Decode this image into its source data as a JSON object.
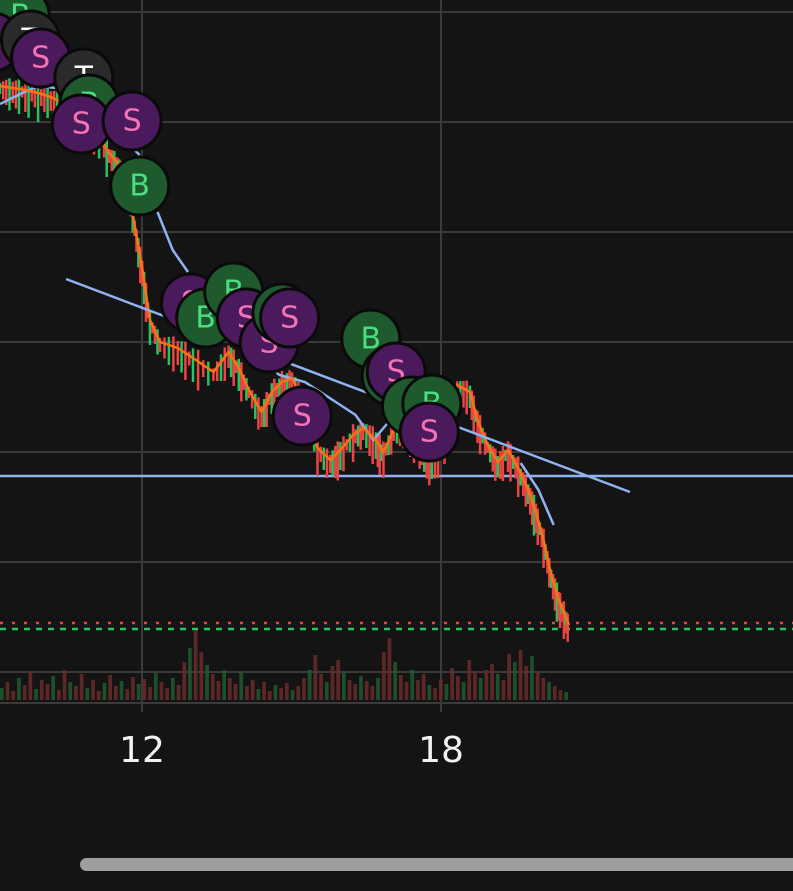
{
  "chart_data": {
    "type": "candlestick",
    "x_ticks": [
      "12",
      "18"
    ],
    "grid": true,
    "colors": {
      "background": "#141414",
      "grid": "#3a3a3a",
      "up_candle": "#22c55e",
      "down_candle": "#ef4444",
      "price_line": "#f97316",
      "moving_average": "#8fb3f0",
      "trendline": "#8fb3f0",
      "support_line": "#8fb3f0",
      "last_price_dotted": "#ef4444",
      "reference_dashed": "#22c55e",
      "buy_marker_fill": "#1f5a2e",
      "buy_marker_text": "#4ade80",
      "sell_marker_fill": "#4a1a5c",
      "sell_marker_text": "#f472b6",
      "volume": "#6b2a2a"
    },
    "price_series": [
      {
        "t": 0.0,
        "p": 86
      },
      {
        "t": 0.5,
        "p": 88
      },
      {
        "t": 1.0,
        "p": 90
      },
      {
        "t": 1.5,
        "p": 93
      },
      {
        "t": 2.0,
        "p": 97
      },
      {
        "t": 2.5,
        "p": 103
      },
      {
        "t": 3.0,
        "p": 114
      },
      {
        "t": 3.4,
        "p": 122
      },
      {
        "t": 3.8,
        "p": 128
      },
      {
        "t": 4.2,
        "p": 150
      },
      {
        "t": 4.6,
        "p": 162
      },
      {
        "t": 4.8,
        "p": 175
      },
      {
        "t": 5.0,
        "p": 180
      },
      {
        "t": 5.3,
        "p": 225
      },
      {
        "t": 5.6,
        "p": 268
      },
      {
        "t": 5.9,
        "p": 320
      },
      {
        "t": 6.3,
        "p": 342
      },
      {
        "t": 7.0,
        "p": 348
      },
      {
        "t": 7.6,
        "p": 358
      },
      {
        "t": 8.4,
        "p": 372
      },
      {
        "t": 9.0,
        "p": 352
      },
      {
        "t": 9.4,
        "p": 368
      },
      {
        "t": 9.8,
        "p": 390
      },
      {
        "t": 10.3,
        "p": 412
      },
      {
        "t": 10.7,
        "p": 392
      },
      {
        "t": 11.1,
        "p": 382
      },
      {
        "t": 11.5,
        "p": 378
      },
      {
        "t": 12.0,
        "p": 405
      },
      {
        "t": 12.5,
        "p": 448
      },
      {
        "t": 13.0,
        "p": 460
      },
      {
        "t": 13.4,
        "p": 450
      },
      {
        "t": 13.9,
        "p": 435
      },
      {
        "t": 14.3,
        "p": 428
      },
      {
        "t": 14.8,
        "p": 440
      },
      {
        "t": 15.1,
        "p": 452
      },
      {
        "t": 15.5,
        "p": 430
      },
      {
        "t": 16.0,
        "p": 420
      },
      {
        "t": 16.3,
        "p": 438
      },
      {
        "t": 16.6,
        "p": 455
      },
      {
        "t": 17.0,
        "p": 462
      },
      {
        "t": 17.5,
        "p": 440
      },
      {
        "t": 18.0,
        "p": 385
      },
      {
        "t": 18.5,
        "p": 392
      },
      {
        "t": 18.8,
        "p": 420
      },
      {
        "t": 19.2,
        "p": 445
      },
      {
        "t": 19.6,
        "p": 462
      },
      {
        "t": 20.0,
        "p": 450
      },
      {
        "t": 20.4,
        "p": 468
      },
      {
        "t": 20.8,
        "p": 490
      },
      {
        "t": 21.1,
        "p": 512
      },
      {
        "t": 21.4,
        "p": 540
      },
      {
        "t": 21.7,
        "p": 575
      },
      {
        "t": 22.0,
        "p": 600
      },
      {
        "t": 22.2,
        "p": 612
      },
      {
        "t": 22.4,
        "p": 625
      }
    ],
    "moving_average": [
      {
        "t": 0.0,
        "p": 104
      },
      {
        "t": 0.8,
        "p": 94
      },
      {
        "t": 1.5,
        "p": 86
      },
      {
        "t": 2.2,
        "p": 88
      },
      {
        "t": 3.0,
        "p": 90
      },
      {
        "t": 4.0,
        "p": 108
      },
      {
        "t": 4.8,
        "p": 138
      },
      {
        "t": 5.5,
        "p": 155
      }
    ],
    "moving_average_2": [
      {
        "t": 6.2,
        "p": 212
      },
      {
        "t": 6.8,
        "p": 250
      },
      {
        "t": 7.4,
        "p": 272
      }
    ],
    "moving_average_3": [
      {
        "t": 9.0,
        "p": 330
      },
      {
        "t": 10.0,
        "p": 352
      },
      {
        "t": 11.0,
        "p": 375
      },
      {
        "t": 12.0,
        "p": 382
      },
      {
        "t": 12.8,
        "p": 395
      },
      {
        "t": 14.0,
        "p": 415
      },
      {
        "t": 14.7,
        "p": 440
      },
      {
        "t": 15.3,
        "p": 422
      }
    ],
    "moving_average_4": [
      {
        "t": 20.5,
        "p": 463
      },
      {
        "t": 21.2,
        "p": 490
      },
      {
        "t": 21.8,
        "p": 525
      }
    ],
    "trendline": {
      "from": {
        "t": 2.6,
        "p": 279
      },
      "to": {
        "t": 24.8,
        "p": 492
      }
    },
    "support_level": {
      "p": 476
    },
    "last_price_level": {
      "p": 623
    },
    "reference_level": {
      "p": 629
    },
    "markers": [
      {
        "kind": "B",
        "t": 0.8,
        "p": 16
      },
      {
        "kind": "S",
        "t": -0.3,
        "p": 42
      },
      {
        "kind": "T",
        "t": 1.2,
        "p": 40
      },
      {
        "kind": "S",
        "t": 1.6,
        "p": 58
      },
      {
        "kind": "T",
        "t": 3.3,
        "p": 78
      },
      {
        "kind": "B",
        "t": 3.5,
        "p": 104
      },
      {
        "kind": "S",
        "t": 3.2,
        "p": 124
      },
      {
        "kind": "S",
        "t": 5.2,
        "p": 121
      },
      {
        "kind": "B",
        "t": 5.5,
        "p": 186
      },
      {
        "kind": "S",
        "t": 7.5,
        "p": 303
      },
      {
        "kind": "B",
        "t": 8.1,
        "p": 318
      },
      {
        "kind": "B",
        "t": 9.2,
        "p": 292
      },
      {
        "kind": "S",
        "t": 9.7,
        "p": 318
      },
      {
        "kind": "S",
        "t": 10.6,
        "p": 343
      },
      {
        "kind": "B",
        "t": 11.1,
        "p": 313
      },
      {
        "kind": "S",
        "t": 11.4,
        "p": 318
      },
      {
        "kind": "S",
        "t": 11.9,
        "p": 416
      },
      {
        "kind": "B",
        "t": 14.6,
        "p": 339
      },
      {
        "kind": "B",
        "t": 15.4,
        "p": 376
      },
      {
        "kind": "S",
        "t": 15.6,
        "p": 372
      },
      {
        "kind": "B",
        "t": 16.2,
        "p": 406
      },
      {
        "kind": "B",
        "t": 17.0,
        "p": 404
      },
      {
        "kind": "S",
        "t": 16.9,
        "p": 432
      }
    ],
    "volume": [
      12,
      18,
      9,
      22,
      15,
      28,
      11,
      20,
      16,
      24,
      10,
      30,
      18,
      14,
      26,
      12,
      20,
      9,
      17,
      25,
      14,
      19,
      11,
      23,
      16,
      21,
      13,
      27,
      18,
      12,
      22,
      15,
      38,
      52,
      70,
      48,
      35,
      26,
      19,
      30,
      22,
      16,
      28,
      14,
      20,
      11,
      18,
      9,
      15,
      12,
      17,
      10,
      14,
      22,
      30,
      45,
      26,
      18,
      34,
      40,
      28,
      20,
      16,
      24,
      19,
      14,
      22,
      48,
      62,
      38,
      25,
      18,
      30,
      20,
      26,
      15,
      12,
      20,
      16,
      32,
      24,
      18,
      40,
      28,
      22,
      30,
      36,
      26,
      20,
      46,
      38,
      50,
      34,
      44,
      28,
      22,
      18,
      14,
      10,
      8
    ]
  }
}
